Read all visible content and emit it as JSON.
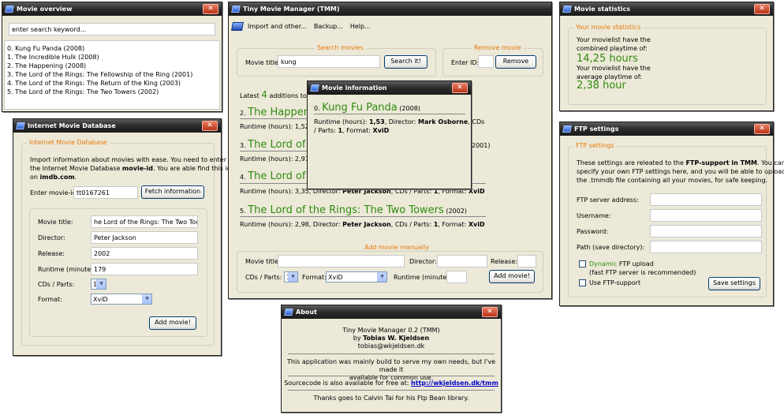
{
  "overview": {
    "title": "Movie overview",
    "search_placeholder": "enter search keyword...",
    "items": [
      "0. Kung Fu Panda (2008)",
      "1. The Incredible Hulk (2008)",
      "2. The Happening (2008)",
      "3. The Lord of the Rings: The Fellowship of the Ring (2001)",
      "4. The Lord of the Rings: The Return of the King (2003)",
      "5. The Lord of the Rings: The Two Towers (2002)"
    ]
  },
  "imdb": {
    "title": "Internet Movie Database",
    "group": "Internet Movie Database",
    "desc1": "Import information about movies with ease. You need to enter",
    "desc2_pre": "the Internet Movie Database ",
    "desc2_bold": "movie-id",
    "desc2_post": ". You are able find this id",
    "desc3_pre": "on ",
    "desc3_bold": "imdb.com",
    "desc3_post": ".",
    "enter_id_label": "Enter movie-id:",
    "movie_id": "tt0167261",
    "fetch_button": "Fetch information",
    "movie_title_label": "Movie title:",
    "movie_title": "he Lord of the Rings: The Two Towers",
    "director_label": "Director:",
    "director": "Peter Jackson",
    "release_label": "Release:",
    "release": "2002",
    "runtime_label": "Runtime (minutes):",
    "runtime": "179",
    "cds_label": "CDs / Parts:",
    "cds": "1",
    "format_label": "Format:",
    "format": "XviD",
    "add_button": "Add movie!"
  },
  "tmm": {
    "title": "Tiny Movie Manager (TMM)",
    "menu": [
      "Import and other...",
      "Backup...",
      "Help..."
    ],
    "search_group": "Search movies",
    "movie_title_label": "Movie title:",
    "search_value": "kung",
    "search_button": "Search it!",
    "remove_group": "Remove movie",
    "enter_id_label": "Enter ID:",
    "remove_button": "Remove",
    "latest_pre": "Latest ",
    "latest_count": "4",
    "latest_post": " additions to yo",
    "movies": [
      {
        "num": "2.",
        "title": "The Happenin",
        "year": "",
        "info": "Runtime (hours): 1,52, Di"
      },
      {
        "num": "3.",
        "title": "The Lord of t",
        "year": "2001)",
        "info": "Runtime (hours): 2,97, Di"
      },
      {
        "num": "4.",
        "title": "The Lord of t",
        "year": "",
        "info": "Runtime (hours): 3,35, Director: Peter Jackson, CDs / Parts: 1, Format: XviD"
      },
      {
        "num": "5.",
        "title": "The Lord of the Rings: The Two Towers",
        "year": "(2002)",
        "info": "Runtime (hours): 2,98, Director: Peter Jackson, CDs / Parts: 1, Format: XviD"
      }
    ],
    "manual_group": "Add movie manually",
    "manual_title_label": "Movie title:",
    "manual_director_label": "Director:",
    "manual_release_label": "Release:",
    "manual_cds_label": "CDs / Parts:",
    "manual_cds": "1",
    "manual_format_label": "Format:",
    "manual_format": "XviD",
    "manual_runtime_label": "Runtime (minutes):",
    "manual_add_button": "Add movie!"
  },
  "info": {
    "title": "Movie information",
    "num": "0.",
    "movie": "Kung Fu Panda",
    "year": "(2008)",
    "line1": "Runtime (hours): 1,53, Director: Mark Osborne, CDs",
    "line2": "/ Parts: 1, Format: XviD"
  },
  "stats": {
    "title": "Movie statistics",
    "group": "Your movie statistics",
    "text1a": "Your movielist have the",
    "text1b": "combined playtime of:",
    "value1": "14,25 hours",
    "text2a": "Your movielist have the",
    "text2b": "average playtime of:",
    "value2": "2,38 hour"
  },
  "ftp": {
    "title": "FTP settings",
    "group": "FTP settings",
    "desc1": "These settings are releated to the FTP-support in TMM. You can",
    "desc2": "specify your own FTP settings here, and you will be able to upload",
    "desc3": "the .tmmdb file containing all your movies, for safe keeping.",
    "server_label": "FTP server address:",
    "user_label": "Username:",
    "pass_label": "Password:",
    "path_label": "Path (save directory):",
    "dynamic_label_a": "Dynamic",
    "dynamic_label_b": " FTP upload",
    "dynamic_note": "(fast FTP server is recommended)",
    "use_ftp_label": "Use FTP-support",
    "save_button": "Save settings"
  },
  "about": {
    "title": "About",
    "line1": "Tiny Movie Manager 0.2 (TMM)",
    "line2_pre": "by ",
    "line2_name": "Tobias W. Kjeldsen",
    "email": "tobias@wkjeldsen.dk",
    "para1": "This application was mainly build to serve my own needs, but I've made it",
    "para2": "available for common use.",
    "source_pre": "Sourcecode is also available for free at: ",
    "source_link": "http://wkjeldsen.dk/tmm",
    "thanks": "Thanks goes to Calvin Tai for his Ftp Bean library."
  }
}
